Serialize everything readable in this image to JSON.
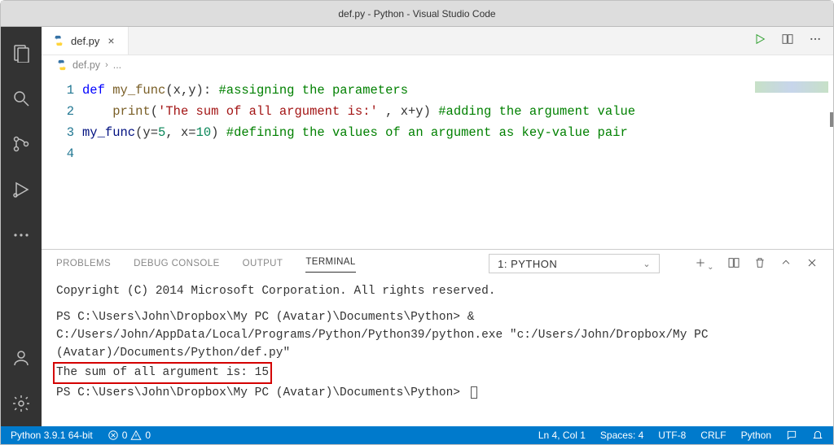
{
  "window": {
    "title": "def.py - Python - Visual Studio Code"
  },
  "tab": {
    "filename": "def.py",
    "close": "×"
  },
  "breadcrumb": {
    "file": "def.py",
    "more": "..."
  },
  "gutter": {
    "l1": "1",
    "l2": "2",
    "l3": "3",
    "l4": "4"
  },
  "code": {
    "l1_kw": "def ",
    "l1_fn": "my_func",
    "l1_args": "(x,y): ",
    "l1_cm": "#assigning the parameters",
    "l2_indent": "    ",
    "l2_print": "print",
    "l2_open": "(",
    "l2_str": "'The sum of all argument is:'",
    "l2_mid": " , x+y) ",
    "l2_cm": "#adding the argument value",
    "l3_call": "my_func",
    "l3_open": "(y=",
    "l3_n1": "5",
    "l3_mid": ", x=",
    "l3_n2": "10",
    "l3_close": ") ",
    "l3_cm": "#defining the values of an argument as key-value pair"
  },
  "panel": {
    "tabs": {
      "problems": "PROBLEMS",
      "debug": "DEBUG CONSOLE",
      "output": "OUTPUT",
      "terminal": "TERMINAL"
    },
    "select": {
      "label": "1: Python"
    }
  },
  "terminal": {
    "line1": "Copyright (C) 2014 Microsoft Corporation. All rights reserved.",
    "line2_a": "PS C:\\Users\\John\\Dropbox\\My PC (Avatar)\\Documents\\Python> ",
    "line2_b": "& C:/Users/John/AppData/Local/Programs/Python/Python39/python.exe \"c:/Users/John/Dropbox/My PC (Avatar)/Documents/Python/def.py\"",
    "line3": "The sum of all argument is: 15",
    "line4": "PS C:\\Users\\John\\Dropbox\\My PC (Avatar)\\Documents\\Python> "
  },
  "status": {
    "python": "Python 3.9.1 64-bit",
    "errors": "0",
    "warnings": "0",
    "lncol": "Ln 4, Col 1",
    "spaces": "Spaces: 4",
    "enc": "UTF-8",
    "eol": "CRLF",
    "lang": "Python"
  }
}
